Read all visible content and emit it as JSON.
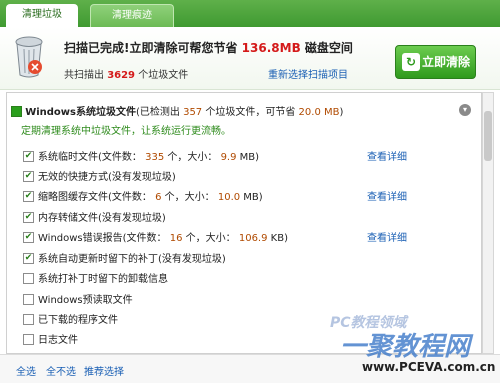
{
  "tabs": [
    {
      "label": "清理垃圾",
      "active": true
    },
    {
      "label": "清理痕迹",
      "active": false
    }
  ],
  "summary": {
    "line1_prefix": "扫描已完成!立即清除可帮您节省",
    "line1_size": "136.8MB",
    "line1_suffix": "磁盘空间",
    "line2_prefix": "共扫描出",
    "line2_count": "3629",
    "line2_suffix": "个垃圾文件",
    "rescan_label": "重新选择扫描项目",
    "clean_button_label": "立即清除",
    "clean_button_icon": "refresh-icon"
  },
  "group": {
    "title": "Windows系统垃圾文件",
    "detected_prefix": "(已检测出",
    "detected_count": "357",
    "detected_mid": "个垃圾文件，可节省",
    "detected_size": "20.0 MB",
    "detected_suffix": ")",
    "description": "定期清理系统中垃圾文件，让系统运行更流畅。"
  },
  "items": [
    {
      "checked": true,
      "label": "系统临时文件(文件数：",
      "count": "335",
      "mid": "个，大小：",
      "size": "9.9",
      "unit": "MB)",
      "detail": "查看详细"
    },
    {
      "checked": true,
      "label": "无效的快捷方式(没有发现垃圾)",
      "count": "",
      "mid": "",
      "size": "",
      "unit": "",
      "detail": ""
    },
    {
      "checked": true,
      "label": "缩略图缓存文件(文件数：",
      "count": "6",
      "mid": "个，大小：",
      "size": "10.0",
      "unit": "MB)",
      "detail": "查看详细"
    },
    {
      "checked": true,
      "label": "内存转储文件(没有发现垃圾)",
      "count": "",
      "mid": "",
      "size": "",
      "unit": "",
      "detail": ""
    },
    {
      "checked": true,
      "label": "Windows错误报告(文件数：",
      "count": "16",
      "mid": "个，大小：",
      "size": "106.9",
      "unit": "KB)",
      "detail": "查看详细"
    },
    {
      "checked": true,
      "label": "系统自动更新时留下的补丁(没有发现垃圾)",
      "count": "",
      "mid": "",
      "size": "",
      "unit": "",
      "detail": ""
    },
    {
      "checked": false,
      "label": "系统打补丁时留下的卸载信息",
      "count": "",
      "mid": "",
      "size": "",
      "unit": "",
      "detail": ""
    },
    {
      "checked": false,
      "label": "Windows预读取文件",
      "count": "",
      "mid": "",
      "size": "",
      "unit": "",
      "detail": ""
    },
    {
      "checked": false,
      "label": "已下载的程序文件",
      "count": "",
      "mid": "",
      "size": "",
      "unit": "",
      "detail": ""
    },
    {
      "checked": false,
      "label": "日志文件",
      "count": "",
      "mid": "",
      "size": "",
      "unit": "",
      "detail": ""
    }
  ],
  "footer": {
    "select_all": "全选",
    "select_none": "全不选",
    "recommended": "推荐选择"
  },
  "watermark": {
    "line1": "PC教程领域",
    "line2": "一聚教程网",
    "line3": "www.PCEVA.com.cn"
  },
  "colors": {
    "accent_green": "#3f9a31",
    "highlight_red": "#d41a1a",
    "link_blue": "#1a5fb4"
  }
}
